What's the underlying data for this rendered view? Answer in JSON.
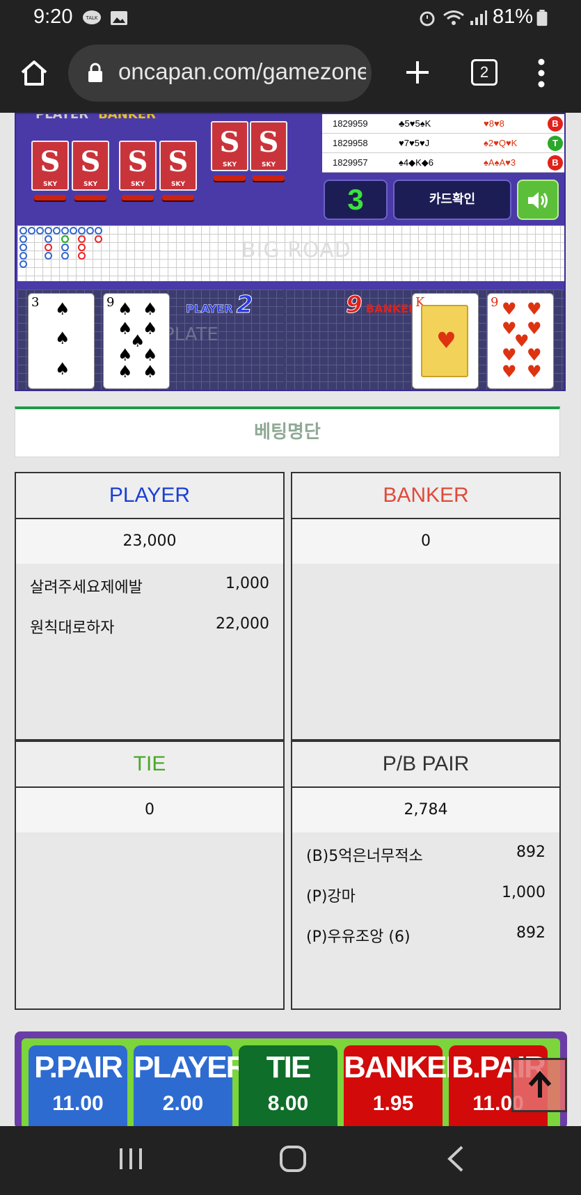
{
  "status_bar": {
    "time": "9:20",
    "battery": "81%"
  },
  "browser": {
    "url": "oncapan.com/gamezone",
    "tab_count": "2"
  },
  "game": {
    "deck_label": "SKY",
    "deck_symbol": "S",
    "history": [
      {
        "id": "1829959",
        "player_cards": "♣5♥5♠K",
        "banker_cards": "♥8♥8",
        "result": "B"
      },
      {
        "id": "1829958",
        "player_cards": "♥7♥5♥J",
        "banker_cards": "♠2♥Q♥K",
        "result": "T"
      },
      {
        "id": "1829957",
        "player_cards": "♠4◆K◆6",
        "banker_cards": "♠A♠A♥3",
        "result": "B"
      }
    ],
    "counter": "3",
    "card_check_label": "카드확인",
    "bigroad_label": "BIG ROAD",
    "plate_label": "PLATE",
    "player_label": "PLAYER",
    "player_score": "2",
    "banker_label": "BANKER",
    "banker_score": "9",
    "player_cards": [
      {
        "rank": "3",
        "suit": "♠",
        "color": "#000000"
      },
      {
        "rank": "9",
        "suit": "♠",
        "color": "#000000"
      }
    ],
    "banker_cards": [
      {
        "rank": "K",
        "suit": "♥",
        "color": "#dd3311"
      },
      {
        "rank": "9",
        "suit": "♥",
        "color": "#dd3311"
      }
    ]
  },
  "betting_list": {
    "title": "베팅명단",
    "panels": {
      "player": {
        "label": "PLAYER",
        "total": "23,000",
        "color": "#1a3fd6",
        "rows": [
          {
            "name": "살려주세요제에발",
            "value": "1,000"
          },
          {
            "name": "원칙대로하자",
            "value": "22,000"
          }
        ]
      },
      "banker": {
        "label": "BANKER",
        "total": "0",
        "color": "#e04a3a",
        "rows": []
      },
      "tie": {
        "label": "TIE",
        "total": "0",
        "color": "#4aa82a",
        "rows": []
      },
      "pair": {
        "label": "P/B PAIR",
        "total": "2,784",
        "color": "#333333",
        "rows": [
          {
            "name": "(B)5억은너무적소",
            "value": "892"
          },
          {
            "name": "(P)강마",
            "value": "1,000"
          },
          {
            "name": "(P)우유조앙 (6)",
            "value": "892"
          }
        ]
      }
    }
  },
  "bet_buttons": [
    {
      "label": "P.PAIR",
      "odds": "11.00",
      "color": "#2d6bd0"
    },
    {
      "label": "PLAYER",
      "odds": "2.00",
      "color": "#2d6bd0"
    },
    {
      "label": "TIE",
      "odds": "8.00",
      "color": "#0f6e2a"
    },
    {
      "label": "BANKER",
      "odds": "1.95",
      "color": "#d20a0a"
    },
    {
      "label": "B.PAIR",
      "odds": "11.00",
      "color": "#d20a0a"
    }
  ]
}
